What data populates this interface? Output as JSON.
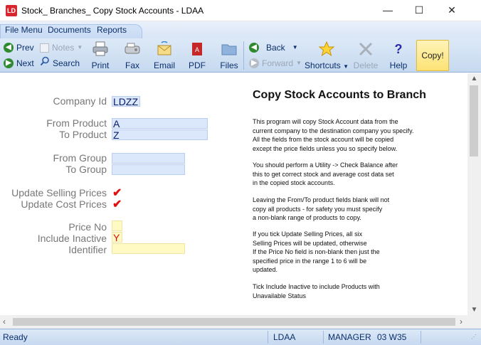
{
  "window": {
    "title": "Stock_ Branches_ Copy Stock Accounts - LDAA",
    "app_icon_text": "LD",
    "minimize": "—",
    "maximize": "☐",
    "close": "✕"
  },
  "menu": {
    "file": "File Menu",
    "documents": "Documents",
    "reports": "Reports"
  },
  "toolbar": {
    "prev": "Prev",
    "next": "Next",
    "notes": "Notes",
    "search": "Search",
    "print": "Print",
    "fax": "Fax",
    "email": "Email",
    "pdf": "PDF",
    "files": "Files",
    "back": "Back",
    "forward": "Forward",
    "shortcuts": "Shortcuts",
    "delete": "Delete",
    "help": "Help",
    "copy": "Copy!"
  },
  "form": {
    "company_id_label": "Company Id",
    "company_id_value": "LDZZ",
    "from_product_label": "From Product",
    "from_product_value": "A",
    "to_product_label": "To Product",
    "to_product_value": "Z",
    "from_group_label": "From Group",
    "from_group_value": "",
    "to_group_label": "To Group",
    "to_group_value": "",
    "update_selling_label": "Update Selling Prices",
    "update_selling_value": "✔",
    "update_cost_label": "Update Cost Prices",
    "update_cost_value": "✔",
    "price_no_label": "Price No",
    "price_no_value": "",
    "include_inactive_label": "Include Inactive",
    "include_inactive_value": "Y",
    "identifier_label": "Identifier",
    "identifier_value": ""
  },
  "help": {
    "heading": "Copy Stock Accounts to Branch",
    "p1": [
      "This program will copy Stock Account data from the",
      "current company to the destination company you specify.",
      "All the fields from the stock account will be copied",
      "except the price fields unless you so specify below."
    ],
    "p2": [
      "You should perform a Utility -> Check Balance after",
      "this to get correct stock and average cost data set",
      "in the copied stock accounts."
    ],
    "p3": [
      "Leaving the From/To product fields blank will not",
      "copy all products - for safety you must specify",
      "a non-blank range of products to copy."
    ],
    "p4": [
      "If you tick Update Selling Prices, all six",
      "Selling Prices will be updated, otherwise",
      "If the Price No field is non-blank then just the",
      "specified price in the range 1 to 6 will be",
      "updated."
    ],
    "p5": [
      "Tick Include Inactive to include Products with",
      "Unavailable Status"
    ]
  },
  "status": {
    "state": "Ready",
    "company": "LDAA",
    "user": "MANAGER",
    "period": "03 W35"
  }
}
